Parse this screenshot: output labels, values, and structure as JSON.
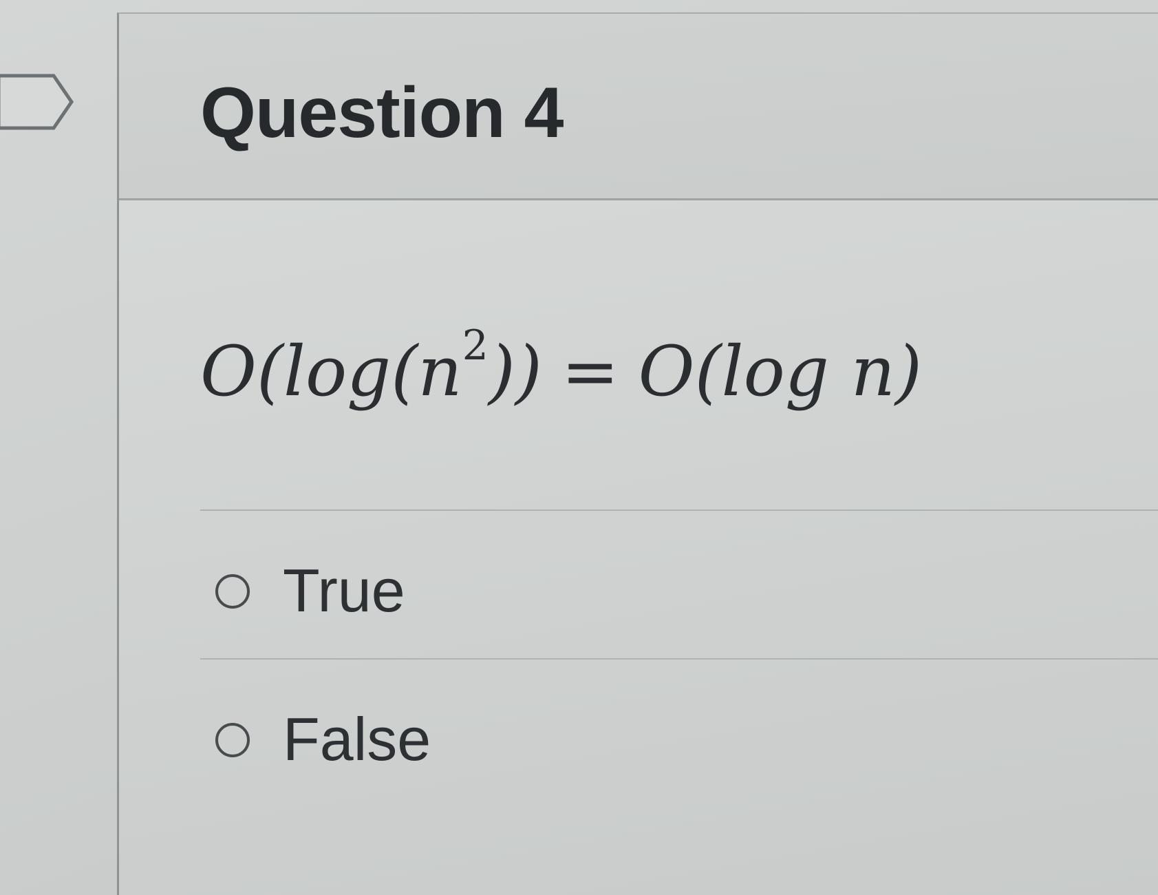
{
  "question": {
    "title": "Question 4",
    "statement": {
      "lhs_prefix": "O(log(n",
      "lhs_exponent": "2",
      "lhs_suffix": "))",
      "relation": "=",
      "rhs": "O(log n)"
    }
  },
  "answers": [
    {
      "label": "True",
      "selected": false
    },
    {
      "label": "False",
      "selected": false
    }
  ],
  "icons": {
    "question_marker": "flag-marker-icon",
    "radio": "radio-unselected-icon"
  },
  "colors": {
    "text": "#262a2c",
    "divider": "#9ea3a2",
    "radio_border": "#464b4d"
  }
}
